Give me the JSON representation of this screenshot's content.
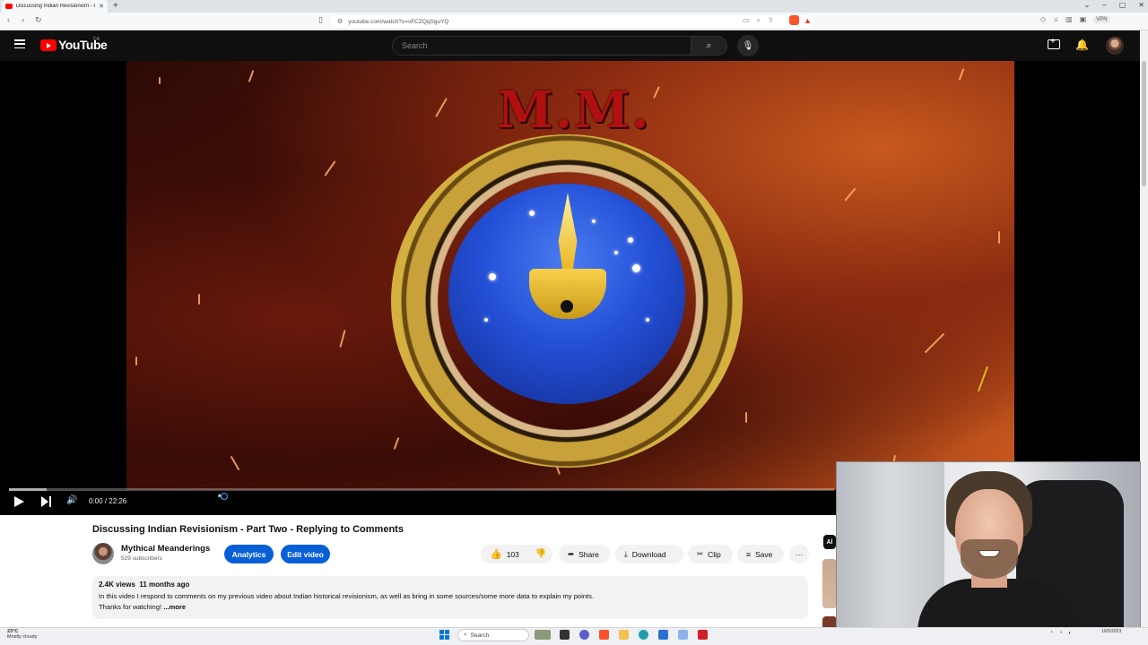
{
  "browser": {
    "tab_title": "Discussing Indian Revisionism - P",
    "url": "youtube.com/watch?v=vFCZQqSguYQ",
    "new_tab": "+",
    "vpn": "VPN"
  },
  "header": {
    "logo_text": "YouTube",
    "region": "CA",
    "search_placeholder": "Search"
  },
  "player": {
    "overlay_text": "M.M.",
    "time": "0:00 / 22:26",
    "progress": 0.0
  },
  "video": {
    "title": "Discussing Indian Revisionism - Part Two - Replying to Comments",
    "channel_name": "Mythical Meanderings",
    "subscribers": "529 subscribers",
    "analytics_label": "Analytics",
    "edit_label": "Edit video",
    "likes": "103",
    "share_label": "Share",
    "download_label": "Download",
    "clip_label": "Clip",
    "save_label": "Save",
    "more_label": "···",
    "views": "2.4K views",
    "age": "11 months ago",
    "description_line1": "In this video I respond to comments on my previous video about Indian historical revisionism, as well as bring in some sources/some more data to explain my points.",
    "description_line2": "Thanks for watching!",
    "more_text": "...more",
    "sidebar_chip": "Al"
  },
  "taskbar": {
    "temperature": "23°C",
    "weather": "Mostly cloudy",
    "search_label": "Search",
    "date": "10/5/2023"
  },
  "colors": {
    "youtube_red": "#ff0000",
    "primary_blue": "#065fd4",
    "header_bg": "#0f0f0f"
  }
}
